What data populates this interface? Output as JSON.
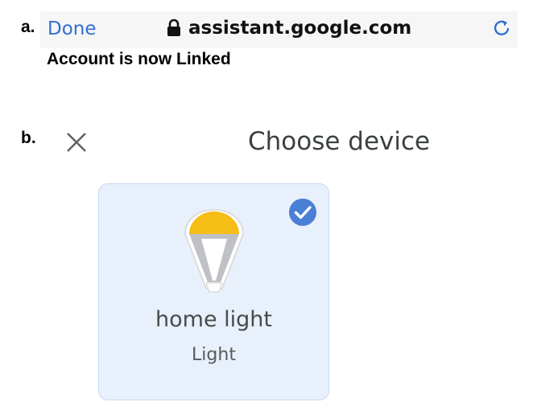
{
  "labels": {
    "a": "a.",
    "b": "b."
  },
  "browser": {
    "done_label": "Done",
    "url": "assistant.google.com",
    "lock_icon": "lock-icon",
    "reload_icon": "reload-icon",
    "accent_color": "#2f6fd1"
  },
  "status_message": "Account is now Linked",
  "dialog": {
    "title": "Choose device",
    "close_icon": "close-icon"
  },
  "device": {
    "name": "home light",
    "type": "Light",
    "selected": true,
    "icon": "light-bulb-icon",
    "card_color": "#e8f0fb",
    "check_color": "#4a7fd6",
    "bulb_color": "#f6bd16"
  }
}
